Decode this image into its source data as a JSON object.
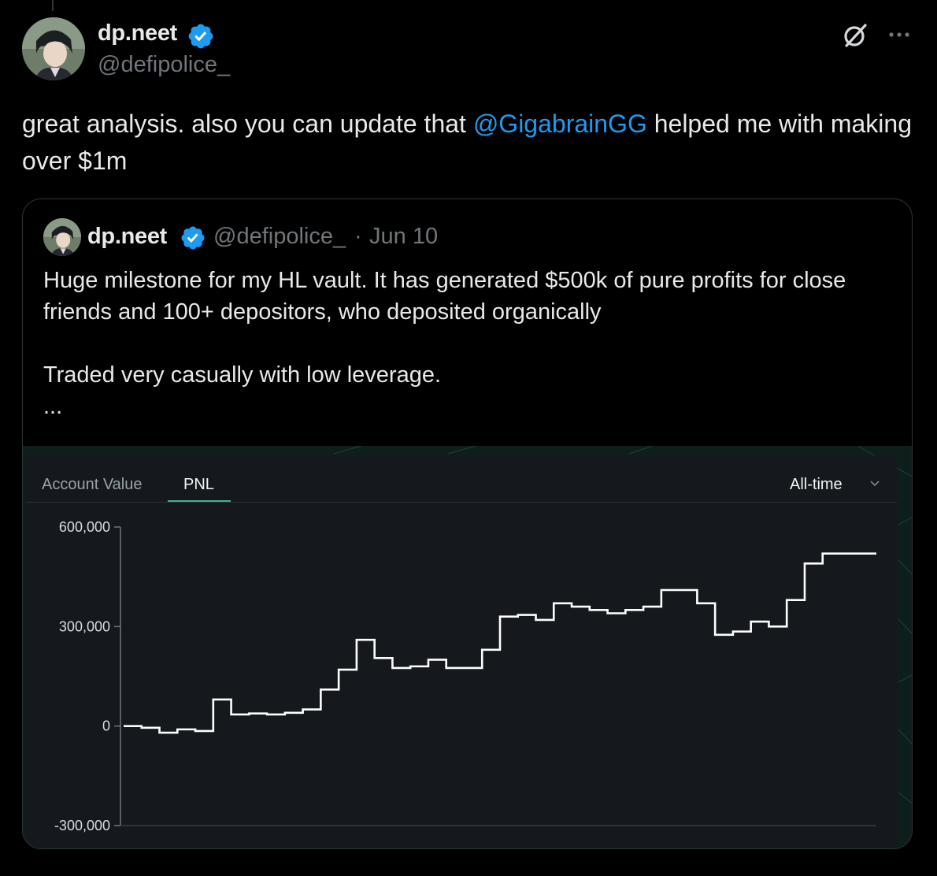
{
  "tweet": {
    "author_name": "dp.neet",
    "author_handle": "@defipolice_",
    "text_before": "great analysis. also you can update that ",
    "mention": "@GigabrainGG",
    "text_after": " helped me with making over $1m",
    "colors": {
      "accent": "#1d9bf0",
      "background": "#000000"
    }
  },
  "quoted_tweet": {
    "author_name": "dp.neet",
    "author_handle": "@defipolice_",
    "separator": "·",
    "date": "Jun 10",
    "paragraph_1": "Huge milestone for my HL vault. It has generated $500k of pure profits for close friends and 100+ depositors, who deposited organically",
    "paragraph_2": "Traded very casually with low leverage.",
    "ellipsis": "..."
  },
  "media": {
    "tabs": [
      {
        "label": "Account Value",
        "active": false
      },
      {
        "label": "PNL",
        "active": true
      }
    ],
    "range_label": "All-time",
    "chart_data": {
      "type": "line",
      "step": true,
      "x": [
        0,
        1,
        2,
        3,
        4,
        5,
        6,
        7,
        8,
        9,
        10,
        11,
        12,
        13,
        14,
        15,
        16,
        17,
        18,
        19,
        20,
        21,
        22,
        23,
        24,
        25,
        26,
        27,
        28,
        29,
        30,
        31,
        32,
        33,
        34,
        35,
        36,
        37,
        38,
        39,
        40,
        41,
        42
      ],
      "y": [
        0,
        -5000,
        -20000,
        -10000,
        -15000,
        80000,
        35000,
        38000,
        35000,
        40000,
        50000,
        110000,
        170000,
        260000,
        205000,
        175000,
        180000,
        200000,
        175000,
        175000,
        230000,
        330000,
        335000,
        320000,
        370000,
        360000,
        350000,
        340000,
        350000,
        360000,
        410000,
        410000,
        370000,
        275000,
        285000,
        315000,
        300000,
        380000,
        490000,
        520000,
        520000,
        520000,
        520000
      ],
      "yticks": [
        600000,
        300000,
        0,
        -300000
      ],
      "ytick_labels": [
        "600,000",
        "300,000",
        "0",
        "-300,000"
      ],
      "ylim": [
        -300000,
        600000
      ],
      "grid": false,
      "line_color": "#ffffff"
    }
  }
}
